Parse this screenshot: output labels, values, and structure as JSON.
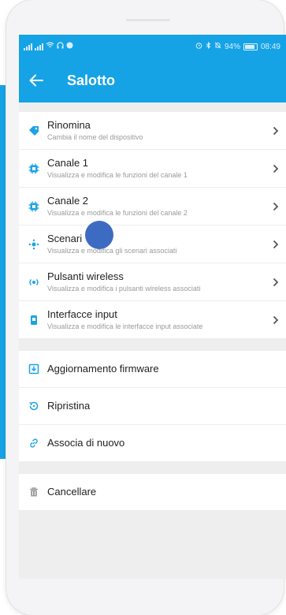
{
  "colors": {
    "accent": "#15a3e6",
    "icon": "#1ba3e4",
    "touch_dot": "#3e6bc2"
  },
  "statusbar": {
    "left_icons": [
      "signal-icon",
      "signal-icon",
      "wifi-icon",
      "headset-icon",
      "chat-icon"
    ],
    "right_icons": [
      "alarm-icon",
      "bluetooth-icon",
      "mute-icon"
    ],
    "battery": "94%",
    "time": "08:49"
  },
  "header": {
    "back_icon": "arrow-left-icon",
    "title": "Salotto"
  },
  "device_items": [
    {
      "icon": "tag-icon",
      "label": "Rinomina",
      "sub": "Cambia il nome del dispositivo"
    },
    {
      "icon": "chip-icon",
      "label": "Canale 1",
      "sub": "Visualizza e modifica le funzioni del canale 1"
    },
    {
      "icon": "chip-icon",
      "label": "Canale 2",
      "sub": "Visualizza e modifica le funzioni del canale 2"
    },
    {
      "icon": "scene-icon",
      "label": "Scenari",
      "sub": "Visualizza e modifica gli scenari associati"
    },
    {
      "icon": "wireless-icon",
      "label": "Pulsanti wireless",
      "sub": "Visualizza e modifica i pulsanti wireless associati"
    },
    {
      "icon": "input-icon",
      "label": "Interfacce input",
      "sub": "Visualizza e modifica le interfacce input associate"
    }
  ],
  "actions": [
    {
      "icon": "download-icon",
      "label": "Aggiornamento firmware"
    },
    {
      "icon": "restore-icon",
      "label": "Ripristina"
    },
    {
      "icon": "link-icon",
      "label": "Associa di nuovo"
    }
  ],
  "delete": {
    "icon": "trash-icon",
    "label": "Cancellare"
  }
}
